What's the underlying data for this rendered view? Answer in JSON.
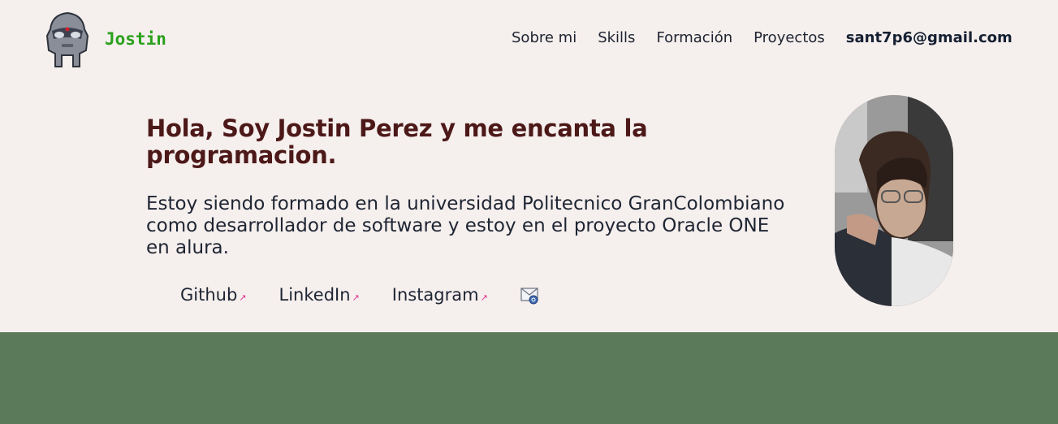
{
  "header": {
    "brand": "Jostin",
    "logo_icon": "metal-mask-icon",
    "nav": [
      "Sobre mi",
      "Skills",
      "Formación",
      "Proyectos"
    ],
    "email": "sant7p6@gmail.com"
  },
  "hero": {
    "title": "Hola, Soy Jostin Perez y me encanta la programacion.",
    "text": "Estoy siendo formado en la universidad Politecnico GranColombiano como desarrollador de software y estoy en el proyecto Oracle ONE en alura.",
    "links": [
      {
        "label": "Github",
        "icon": "external-arrow-icon"
      },
      {
        "label": "LinkedIn",
        "icon": "external-arrow-icon"
      },
      {
        "label": "Instagram",
        "icon": "external-arrow-icon"
      }
    ],
    "mail_icon": "envelope-icon",
    "photo_icon": "profile-photo"
  },
  "colors": {
    "background": "#f5efed",
    "brand": "#2aa11c",
    "title": "#4c1818",
    "text": "#1e2533",
    "arrow": "#e0358f",
    "footer": "#5b7a5a"
  }
}
